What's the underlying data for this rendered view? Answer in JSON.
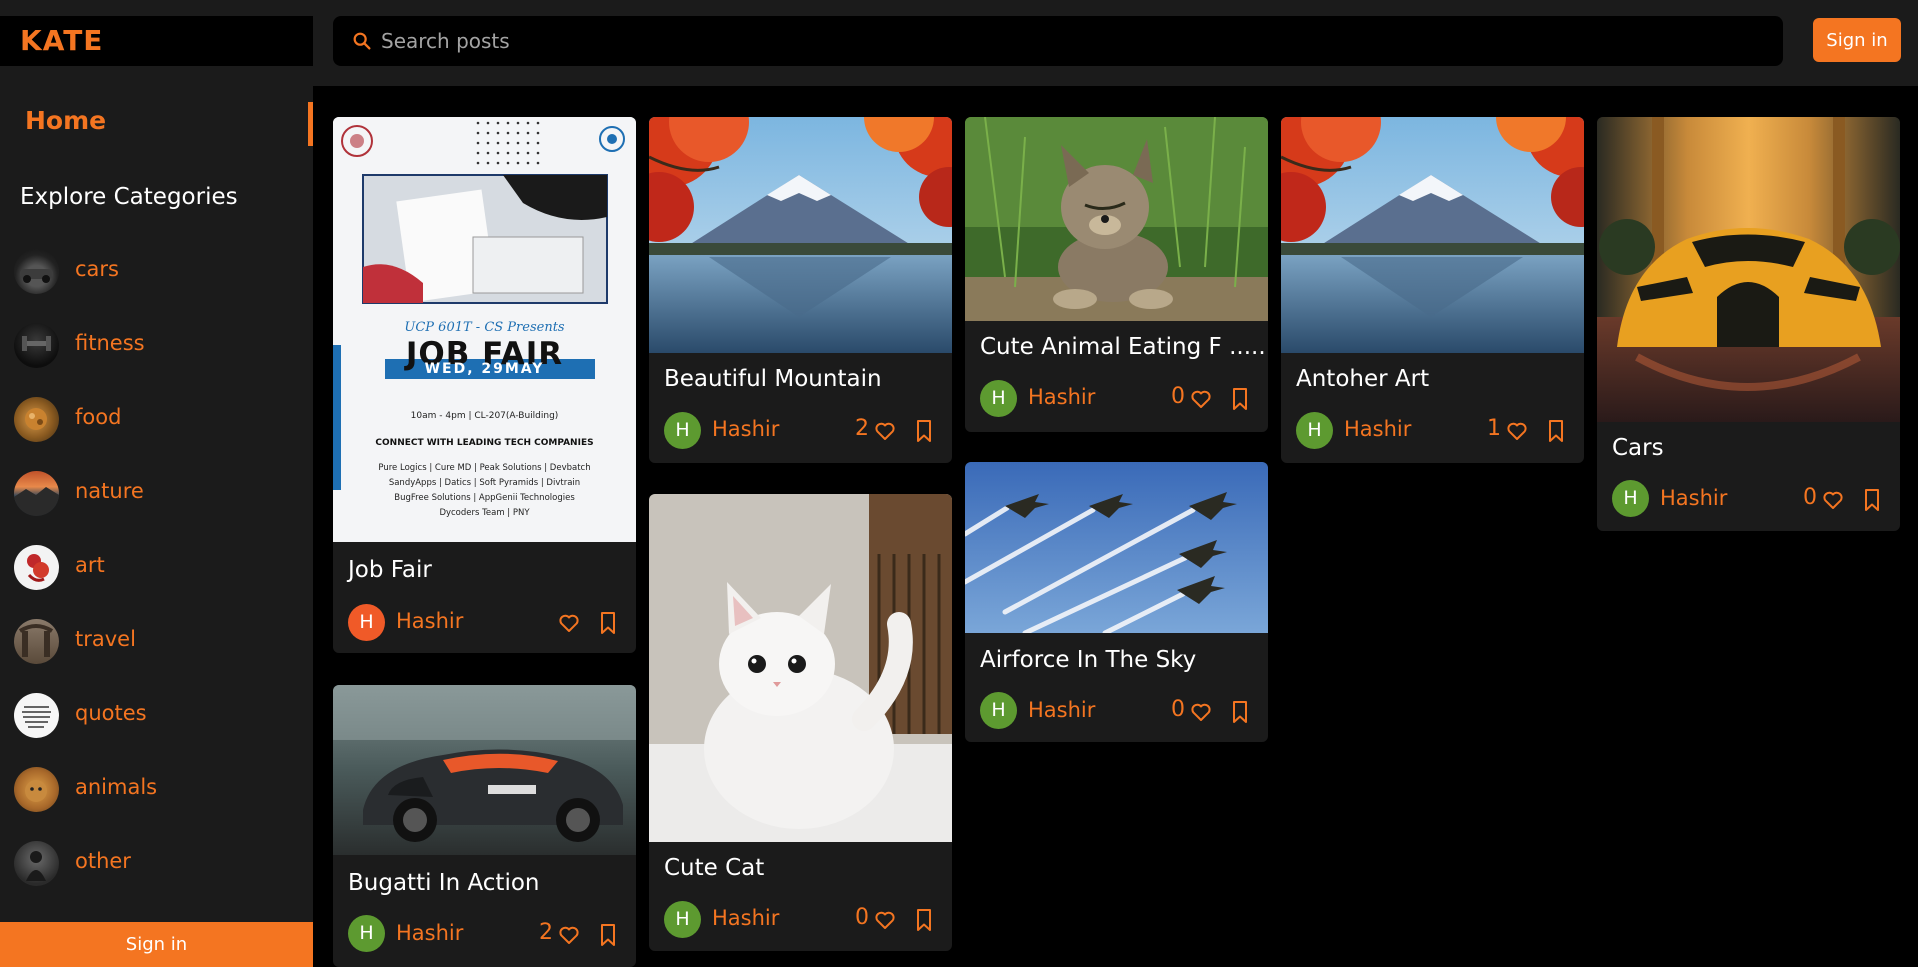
{
  "app": {
    "logo": "KATE"
  },
  "search": {
    "placeholder": "Search posts"
  },
  "header": {
    "signin_label": "Sign in"
  },
  "sidebar": {
    "home_label": "Home",
    "explore_label": "Explore Categories",
    "categories": [
      {
        "label": "cars"
      },
      {
        "label": "fitness"
      },
      {
        "label": "food"
      },
      {
        "label": "nature"
      },
      {
        "label": "art"
      },
      {
        "label": "travel"
      },
      {
        "label": "quotes"
      },
      {
        "label": "animals"
      },
      {
        "label": "other"
      }
    ],
    "signin_label": "Sign in"
  },
  "posts": [
    {
      "title": "Job Fair",
      "author": "Hashir",
      "avatar_letter": "H",
      "likes": "",
      "avatar_color": "#f05a28",
      "poster": {
        "header": "UCP 601T - CS Presents",
        "headline": "JOB FAIR",
        "date": "WED, 29MAY",
        "time": "10am - 4pm | CL-207(A-Building)",
        "connect": "CONNECT  WITH LEADING TECH COMPANIES",
        "companies_1": "Pure Logics | Cure MD | Peak Solutions | Devbatch",
        "companies_2": "SandyApps | Datics | Soft Pyramids | Divtrain",
        "companies_3": "BugFree Solutions | AppGenii Technologies",
        "companies_4": "Dycoders Team | PNY"
      }
    },
    {
      "title": "Bugatti In Action",
      "author": "Hashir",
      "avatar_letter": "H",
      "likes": "2",
      "avatar_color": "#5d9a30"
    },
    {
      "title": "Beautiful Mountain",
      "author": "Hashir",
      "avatar_letter": "H",
      "likes": "2",
      "avatar_color": "#5d9a30"
    },
    {
      "title": "Cute Cat",
      "author": "Hashir",
      "avatar_letter": "H",
      "likes": "0",
      "avatar_color": "#5d9a30"
    },
    {
      "title": "Cute Animal Eating F .....",
      "author": "Hashir",
      "avatar_letter": "H",
      "likes": "0",
      "avatar_color": "#5d9a30"
    },
    {
      "title": "Airforce In The Sky",
      "author": "Hashir",
      "avatar_letter": "H",
      "likes": "0",
      "avatar_color": "#5d9a30"
    },
    {
      "title": "Antoher Art",
      "author": "Hashir",
      "avatar_letter": "H",
      "likes": "1",
      "avatar_color": "#5d9a30"
    },
    {
      "title": "Cars",
      "author": "Hashir",
      "avatar_letter": "H",
      "likes": "0",
      "avatar_color": "#5d9a30"
    }
  ],
  "colors": {
    "accent": "#f47521",
    "panel": "#1b1b1b",
    "background": "#000000"
  }
}
